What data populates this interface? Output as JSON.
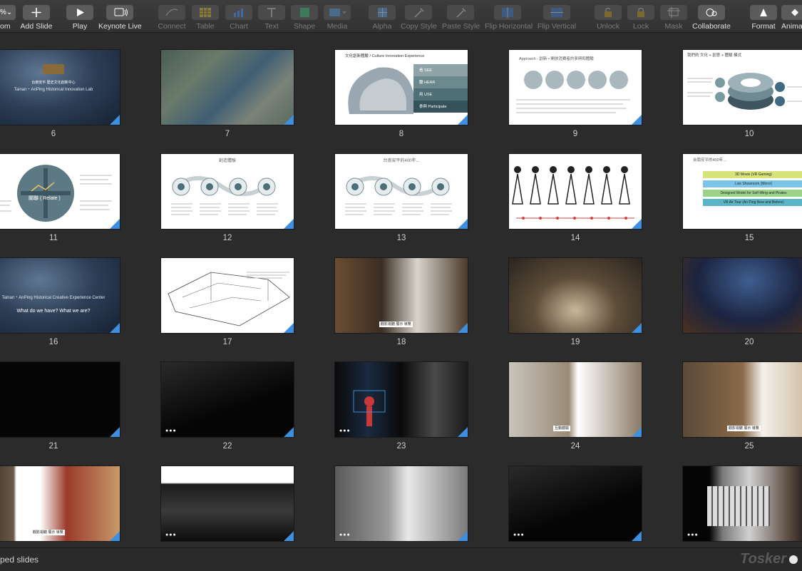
{
  "toolbar": {
    "zoom": "%",
    "items": [
      {
        "label": "om",
        "icon": "zoom-icon",
        "enabled": true
      },
      {
        "label": "Add Slide",
        "icon": "plus-icon",
        "enabled": true
      },
      {
        "label": "Play",
        "icon": "play-icon",
        "enabled": true
      },
      {
        "label": "Keynote Live",
        "icon": "broadcast-icon",
        "enabled": true
      },
      {
        "label": "Connect",
        "icon": "connect-line-icon",
        "enabled": false
      },
      {
        "label": "Table",
        "icon": "table-icon",
        "enabled": false
      },
      {
        "label": "Chart",
        "icon": "chart-icon",
        "enabled": false
      },
      {
        "label": "Text",
        "icon": "text-icon",
        "enabled": false
      },
      {
        "label": "Shape",
        "icon": "shape-icon",
        "enabled": false
      },
      {
        "label": "Media",
        "icon": "media-icon",
        "enabled": false
      },
      {
        "label": "Alpha",
        "icon": "alpha-icon",
        "enabled": false
      },
      {
        "label": "Copy Style",
        "icon": "eyedropper-icon",
        "enabled": false
      },
      {
        "label": "Paste Style",
        "icon": "paste-style-icon",
        "enabled": false
      },
      {
        "label": "Flip Horizontal",
        "icon": "flip-horizontal-icon",
        "enabled": false
      },
      {
        "label": "Flip Vertical",
        "icon": "flip-vertical-icon",
        "enabled": false
      },
      {
        "label": "Unlock",
        "icon": "unlock-icon",
        "enabled": false
      },
      {
        "label": "Lock",
        "icon": "lock-icon",
        "enabled": false
      },
      {
        "label": "Mask",
        "icon": "mask-icon",
        "enabled": false
      },
      {
        "label": "Collaborate",
        "icon": "collaborate-icon",
        "enabled": true
      },
      {
        "label": "Format",
        "icon": "format-brush-icon",
        "enabled": true
      },
      {
        "label": "Anima",
        "icon": "animate-icon",
        "enabled": true
      }
    ]
  },
  "slides": [
    {
      "number": "6",
      "theme": "dark-blue",
      "title": "Tainan・AnPing Historical Innovation Lab",
      "subtitle": "台南安平 歷史文化創新中心"
    },
    {
      "number": "7",
      "theme": "map"
    },
    {
      "number": "8",
      "theme": "brain",
      "title": "文化創新體驗 / Culture Innovation Experience",
      "steps": [
        "看 SEE",
        "聽 HEAR",
        "用 USE",
        "參與 Participate"
      ]
    },
    {
      "number": "9",
      "theme": "circles",
      "title": "Approach - 創新 • 開放消費者的參與和體驗"
    },
    {
      "number": "10",
      "theme": "rings",
      "title": "我們的 文化 + 創意 + 體驗 模式"
    },
    {
      "number": "11",
      "theme": "relate",
      "title": "關聯 ( Relate )"
    },
    {
      "number": "12",
      "theme": "steps4",
      "title": "創造體驗"
    },
    {
      "number": "13",
      "theme": "steps4b",
      "title": "台南安平的400年..."
    },
    {
      "number": "14",
      "theme": "figures"
    },
    {
      "number": "15",
      "theme": "layers",
      "title": "台南安平的400年...",
      "bars": [
        "3D Movie (VR Gaming)",
        "Live Showroom (Mirror)",
        "Designed Model for Self-Wing and Pirates",
        "VR Air Tour (An Ping Now and Before)"
      ]
    },
    {
      "number": "16",
      "theme": "dark-blue",
      "title": "Tainan・AnPing Historical Creative Experience Center",
      "subtitle": "What do we have? What we are?"
    },
    {
      "number": "17",
      "theme": "sketch"
    },
    {
      "number": "18",
      "theme": "photo-warm",
      "caption": "觀影視聽 展示 導覽"
    },
    {
      "number": "19",
      "theme": "photo-museum"
    },
    {
      "number": "20",
      "theme": "photo-night"
    },
    {
      "number": "21",
      "theme": "black"
    },
    {
      "number": "22",
      "theme": "black-dots"
    },
    {
      "number": "23",
      "theme": "photo-red"
    },
    {
      "number": "24",
      "theme": "photo-ship",
      "caption": "互動體驗"
    },
    {
      "number": "25",
      "theme": "photo-exhibit",
      "caption": "觀影視聽 展示 導覽"
    },
    {
      "number": "",
      "theme": "photo-armor",
      "caption": "觀影視聽 展示 導覽"
    },
    {
      "number": "",
      "theme": "photo-hall"
    },
    {
      "number": "",
      "theme": "photo-table"
    },
    {
      "number": "",
      "theme": "black-dots"
    },
    {
      "number": "",
      "theme": "photo-screen"
    }
  ],
  "footer": {
    "status": "ped slides",
    "watermark": "Tosker"
  },
  "colors": {
    "accent": "#3f8fe0",
    "toolbar_bg": "#383838",
    "canvas_bg": "#2b2b2b"
  }
}
